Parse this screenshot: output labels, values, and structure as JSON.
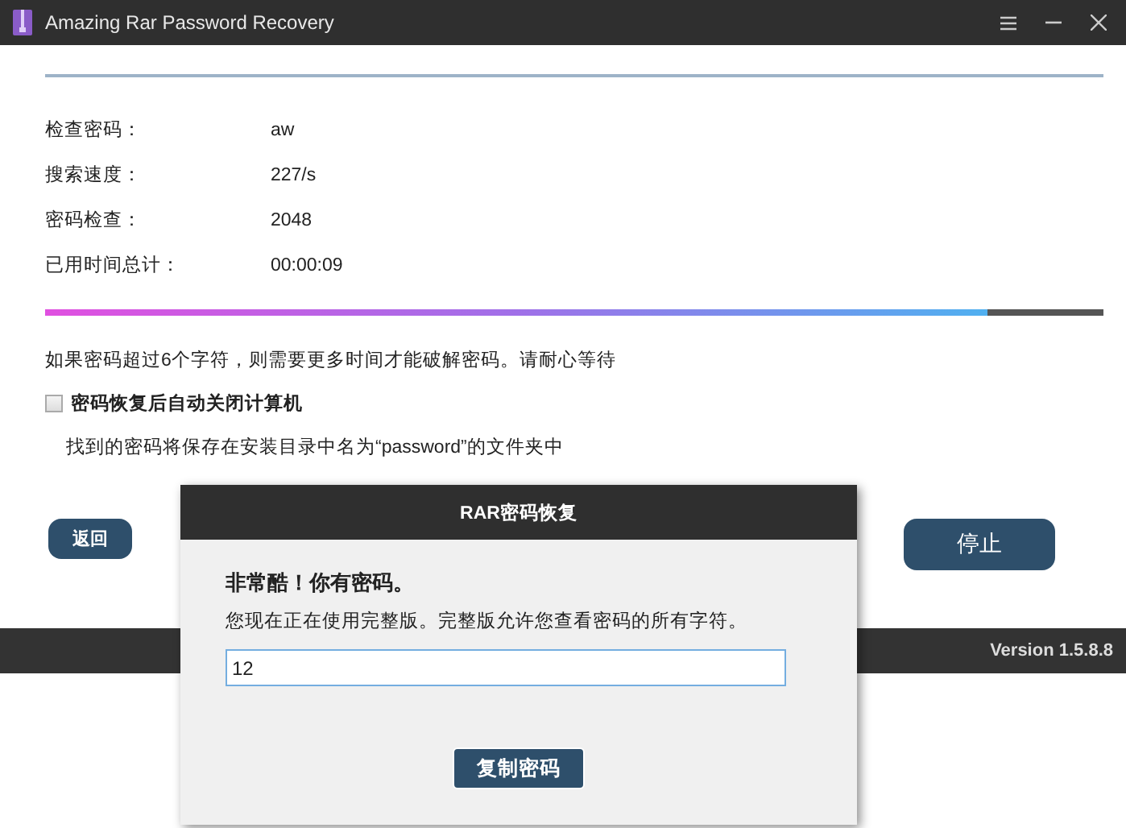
{
  "window": {
    "title": "Amazing Rar Password Recovery"
  },
  "stats": [
    {
      "label": "检查密码：",
      "value": "aw"
    },
    {
      "label": "搜索速度：",
      "value": "227/s"
    },
    {
      "label": "密码检查：",
      "value": "2048"
    },
    {
      "label": "已用时间总计：",
      "value": "00:00:09"
    }
  ],
  "progress": {
    "level": 0.89
  },
  "notice": "如果密码超过6个字符，则需要更多时间才能破解密码。请耐心等待",
  "auto_shutdown": {
    "label": "密码恢复后自动关闭计算机",
    "checked": false
  },
  "save_note": "找到的密码将保存在安装目录中名为“password”的文件夹中",
  "buttons": {
    "back": "返回",
    "stop": "停止"
  },
  "status_bar": {
    "version": "Version 1.5.8.8"
  },
  "dialog": {
    "title": "RAR密码恢复",
    "heading": "非常酷！你有密码。",
    "message": "您现在正在使用完整版。完整版允许您查看密码的所有字符。",
    "password": {
      "value": "12"
    },
    "copy_button": "复制密码"
  }
}
